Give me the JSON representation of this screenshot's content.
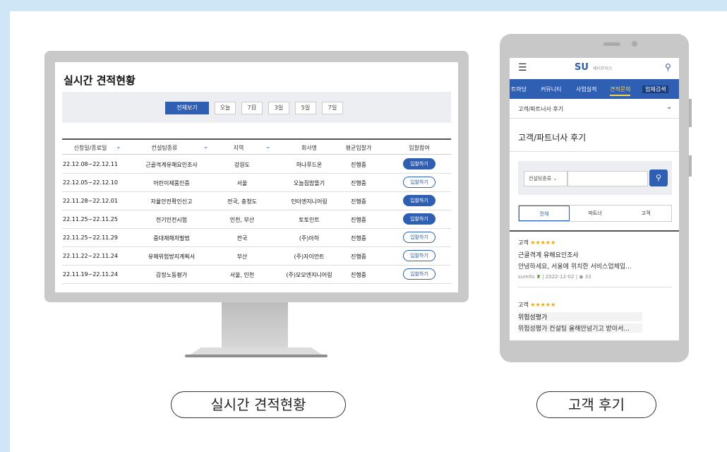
{
  "monitor_page": {
    "title": "실시간 견적현황",
    "filters": [
      "전체보기",
      "오늘",
      "7日",
      "3일",
      "5일",
      "7일"
    ],
    "columns": [
      "신청일/종료일",
      "컨설팅종류",
      "지역",
      "회사명",
      "평균입찰가",
      "입찰참여"
    ],
    "rows": [
      {
        "date": "22.12.08~22.12.11",
        "type": "근골격계유해요인조사",
        "region": "강원도",
        "company": "하나푸드온",
        "avg": "진행중",
        "bid": "입찰하기",
        "bid_style": "filled"
      },
      {
        "date": "22.12.05~22.12.10",
        "type": "어린이제품인증",
        "region": "서울",
        "company": "오늘집밥뜰기",
        "avg": "진행중",
        "bid": "입찰하기",
        "bid_style": "outline"
      },
      {
        "date": "22.11.28~22.12.01",
        "type": "자율안전확인신고",
        "region": "전국, 충청도",
        "company": "인터엔지니어링",
        "avg": "진행중",
        "bid": "입찰하기",
        "bid_style": "filled"
      },
      {
        "date": "22.11.25~22.11.25",
        "type": "전기인전시험",
        "region": "인천, 부산",
        "company": "토토인트",
        "avg": "진행중",
        "bid": "입찰하기",
        "bid_style": "filled"
      },
      {
        "date": "22.11.25~22.11.29",
        "type": "중대재해처벌법",
        "region": "전국",
        "company": "(주)아하",
        "avg": "진행중",
        "bid": "입찰하기",
        "bid_style": "outline"
      },
      {
        "date": "22.11.22~22.11.24",
        "type": "유해위험방지계획서",
        "region": "부산",
        "company": "(주)자이언트",
        "avg": "진행중",
        "bid": "입찰하기",
        "bid_style": "outline"
      },
      {
        "date": "22.11.19~22.11.24",
        "type": "감정노동평가",
        "region": "서울, 인천",
        "company": "(주)모모엔지니어링",
        "avg": "진행중",
        "bid": "입찰하기",
        "bid_style": "outline"
      }
    ]
  },
  "tablet_page": {
    "logo": "SU",
    "logo_sub": "세이프어스",
    "nav": [
      "트마당",
      "커뮤니티",
      "사업실적",
      "견적문의",
      "업체검색"
    ],
    "breadcrumb": "고객/파트너사 후기",
    "heading": "고객/파트너사 후기",
    "search_select": "컨설팅종류",
    "tabs": [
      "전체",
      "파트너",
      "고객"
    ],
    "reviews": [
      {
        "who": "고객",
        "stars": "★★★★★",
        "title": "근골격계 유해요인조사",
        "excerpt": "안녕하세요, 서울에 위치한 서비스업체입...",
        "author": "sureits",
        "date": "2022-12-02",
        "views": "33"
      },
      {
        "who": "고객",
        "stars": "★★★★★",
        "title": "위험성평가",
        "excerpt": "위험성평가 컨설팅 올해안넘기고 받아서...",
        "author": "",
        "date": "",
        "views": ""
      }
    ]
  },
  "captions": {
    "left": "실시간 견적현황",
    "right": "고객 후기"
  },
  "colors": {
    "accent": "#2f5fb2",
    "background": "#cfe6f6"
  }
}
